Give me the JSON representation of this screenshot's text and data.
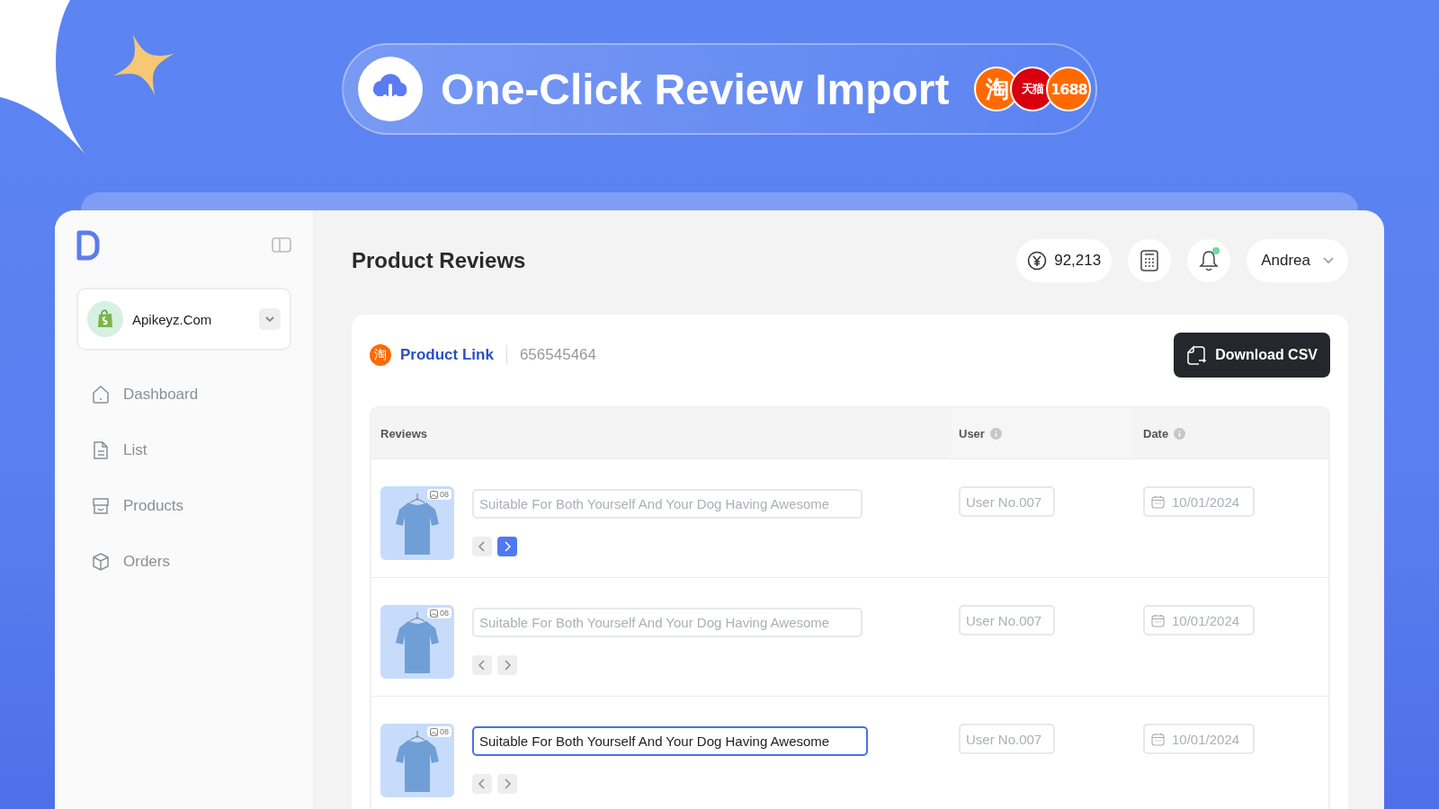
{
  "banner": {
    "title": "One-Click Review Import",
    "platforms": [
      {
        "label": "淘",
        "color": "#ff6a00"
      },
      {
        "label": "天猫",
        "color": "#d8000f"
      },
      {
        "label": "1688",
        "color": "#ff6a00"
      }
    ]
  },
  "sidebar": {
    "store": {
      "name": "Apikeyz.Com"
    },
    "items": [
      {
        "label": "Dashboard",
        "kind": "home"
      },
      {
        "label": "List",
        "kind": "doc"
      },
      {
        "label": "Products",
        "kind": "shop"
      },
      {
        "label": "Orders",
        "kind": "box"
      }
    ]
  },
  "header": {
    "title": "Product Reviews",
    "balance": "92,213",
    "notification_dot": true,
    "user": "Andrea"
  },
  "product": {
    "platform_icon": "淘",
    "link": "Product Link",
    "id": "656545464",
    "button": "Download CSV"
  },
  "table": {
    "columns": [
      "Reviews",
      "User",
      "Date"
    ],
    "rows": [
      {
        "photo_count": "08",
        "review": {
          "placeholder": "Suitable For Both Yourself And Your Dog Having Awesome"
        },
        "next_active": true,
        "user": {
          "placeholder": "User No.007"
        },
        "date": {
          "placeholder": "10/01/2024"
        }
      },
      {
        "photo_count": "08",
        "review": {
          "placeholder": "Suitable For Both Yourself And Your Dog Having Awesome"
        },
        "next_active": false,
        "user": {
          "placeholder": "User No.007"
        },
        "date": {
          "placeholder": "10/01/2024"
        }
      },
      {
        "photo_count": "08",
        "review": {
          "value": "Suitable For Both Yourself And Your Dog Having Awesome",
          "focused": true
        },
        "next_active": false,
        "user": {
          "placeholder": "User No.007"
        },
        "date": {
          "placeholder": "10/01/2024"
        }
      }
    ]
  }
}
